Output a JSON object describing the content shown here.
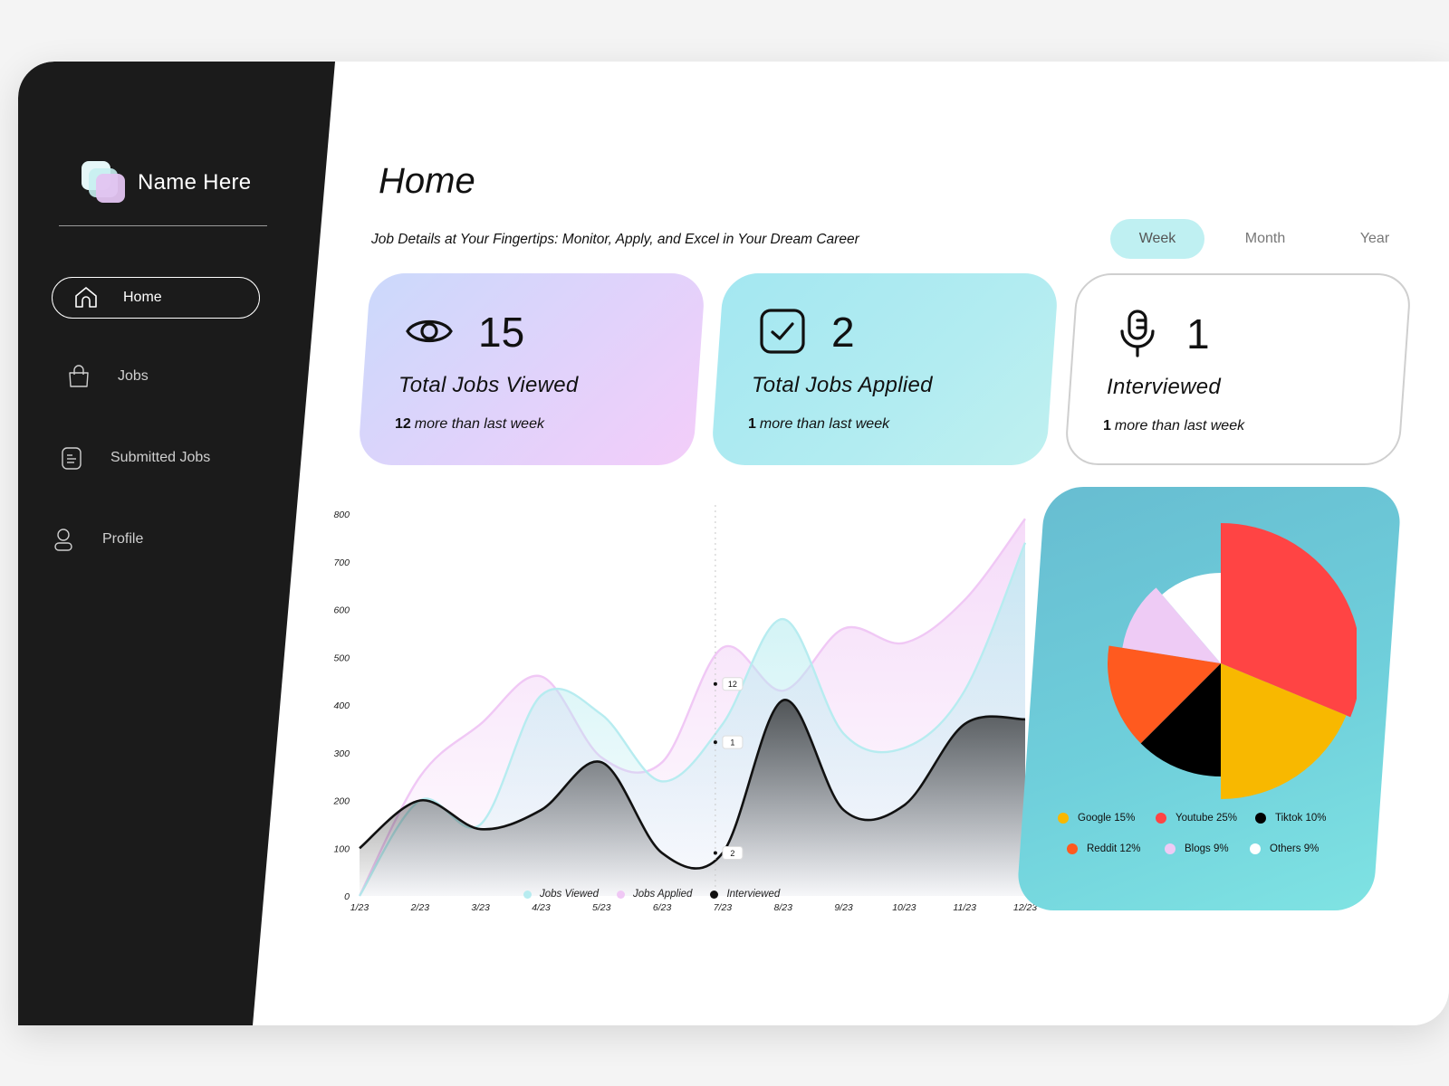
{
  "brand": {
    "name": "Name Here"
  },
  "nav": {
    "items": [
      {
        "label": "Home",
        "icon": "home-icon",
        "active": true
      },
      {
        "label": "Jobs",
        "icon": "bag-icon"
      },
      {
        "label": "Submitted Jobs",
        "icon": "document-icon"
      },
      {
        "label": "Profile",
        "icon": "user-icon"
      }
    ]
  },
  "main": {
    "title": "Home",
    "subtitle": "Job Details at Your Fingertips: Monitor, Apply, and Excel in Your Dream Career",
    "periods": [
      "Week",
      "Month",
      "Year"
    ],
    "active_period": "Week"
  },
  "stats": [
    {
      "icon": "eye-icon",
      "value": "15",
      "label": "Total Jobs Viewed",
      "delta_value": "12",
      "delta_text": "more than last week"
    },
    {
      "icon": "check-square-icon",
      "value": "2",
      "label": "Total Jobs Applied",
      "delta_value": "1",
      "delta_text": "more than last week"
    },
    {
      "icon": "microphone-icon",
      "value": "1",
      "label": "Interviewed",
      "delta_value": "1",
      "delta_text": "more than last week"
    }
  ],
  "colors": {
    "sidebar": "#1b1b1b",
    "jobs_viewed": "#b7ecf0",
    "jobs_applied": "#f0c8f5",
    "interviewed": "#111111",
    "google": "#f8b800",
    "youtube": "#ff4444",
    "tiktok": "#000000",
    "reddit": "#ff5a1f",
    "blogs": "#eecbf5",
    "others": "#ffffff"
  },
  "chart_data": [
    {
      "type": "area",
      "categories": [
        "1/23",
        "2/23",
        "3/23",
        "4/23",
        "5/23",
        "6/23",
        "7/23",
        "8/23",
        "9/23",
        "10/23",
        "11/23",
        "12/23"
      ],
      "ylim": [
        0,
        800
      ],
      "yticks": [
        0,
        100,
        200,
        300,
        400,
        500,
        600,
        700,
        800
      ],
      "series": [
        {
          "name": "Jobs Viewed",
          "values": [
            0,
            200,
            150,
            420,
            380,
            240,
            360,
            580,
            340,
            310,
            430,
            740
          ]
        },
        {
          "name": "Jobs Applied",
          "values": [
            0,
            250,
            360,
            460,
            290,
            280,
            520,
            430,
            560,
            530,
            620,
            790
          ]
        },
        {
          "name": "Interviewed",
          "values": [
            100,
            200,
            140,
            180,
            280,
            90,
            90,
            410,
            180,
            190,
            360,
            370
          ]
        }
      ],
      "annotations": [
        "12",
        "1",
        "2"
      ],
      "legend": "bottom"
    },
    {
      "type": "pie",
      "labels": [
        "Google",
        "Youtube",
        "Tiktok",
        "Reddit",
        "Blogs",
        "Others"
      ],
      "values": [
        15,
        25,
        10,
        12,
        9,
        9
      ],
      "legend_text": [
        "Google 15%",
        "Youtube 25%",
        "Tiktok 10%",
        "Reddit 12%",
        "Blogs 9%",
        "Others 9%"
      ],
      "legend": "bottom"
    }
  ]
}
